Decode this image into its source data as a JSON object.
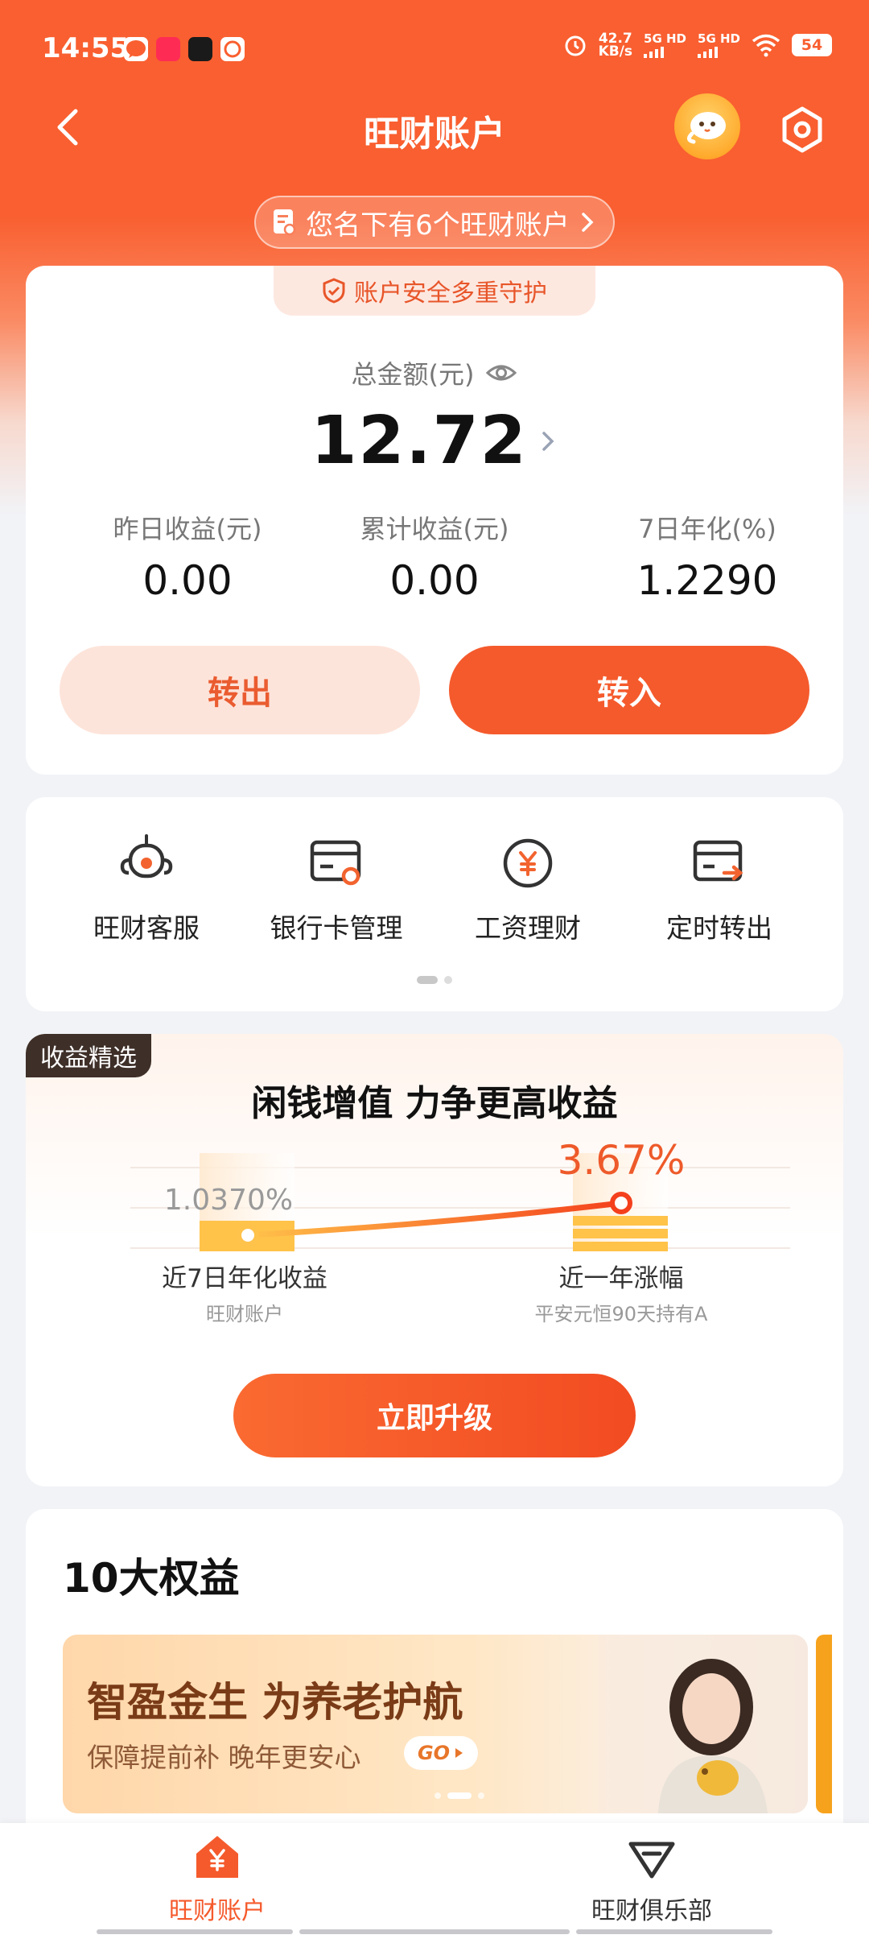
{
  "status_bar": {
    "time": "14:55",
    "speed_value": "42.7",
    "speed_unit": "KB/s",
    "sim1": "5G HD",
    "sim2": "5G HD",
    "battery": "54"
  },
  "header": {
    "title": "旺财账户",
    "accounts_notice": "您名下有6个旺财账户"
  },
  "account": {
    "security_badge": "账户安全多重守护",
    "total_label": "总金额(元)",
    "total_value": "12.72",
    "stats": [
      {
        "label": "昨日收益(元)",
        "value": "0.00"
      },
      {
        "label": "累计收益(元)",
        "value": "0.00"
      },
      {
        "label": "7日年化(%)",
        "value": "1.2290"
      }
    ],
    "transfer_out_label": "转出",
    "transfer_in_label": "转入"
  },
  "shortcuts": [
    {
      "label": "旺财客服",
      "icon": "robot-service-icon"
    },
    {
      "label": "银行卡管理",
      "icon": "bank-card-icon"
    },
    {
      "label": "工资理财",
      "icon": "yen-coin-icon"
    },
    {
      "label": "定时转出",
      "icon": "card-transfer-icon"
    }
  ],
  "promo": {
    "tag": "收益精选",
    "title": "闲钱增值 力争更高收益",
    "left_rate": "1.0370%",
    "left_label": "近7日年化收益",
    "left_sub": "旺财账户",
    "right_rate": "3.67%",
    "right_label": "近一年涨幅",
    "right_sub": "平安元恒90天持有A",
    "button_label": "立即升级"
  },
  "benefits": {
    "title": "10大权益",
    "banner_title": "智盈金生 为养老护航",
    "banner_sub": "保障提前补 晚年更安心",
    "banner_go": "GO"
  },
  "tabbar": {
    "tabs": [
      {
        "label": "旺财账户",
        "active": true
      },
      {
        "label": "旺财俱乐部",
        "active": false
      }
    ]
  },
  "colors": {
    "brand": "#f95f30",
    "accent_text": "#e8562a",
    "button_light": "#fde4da"
  }
}
